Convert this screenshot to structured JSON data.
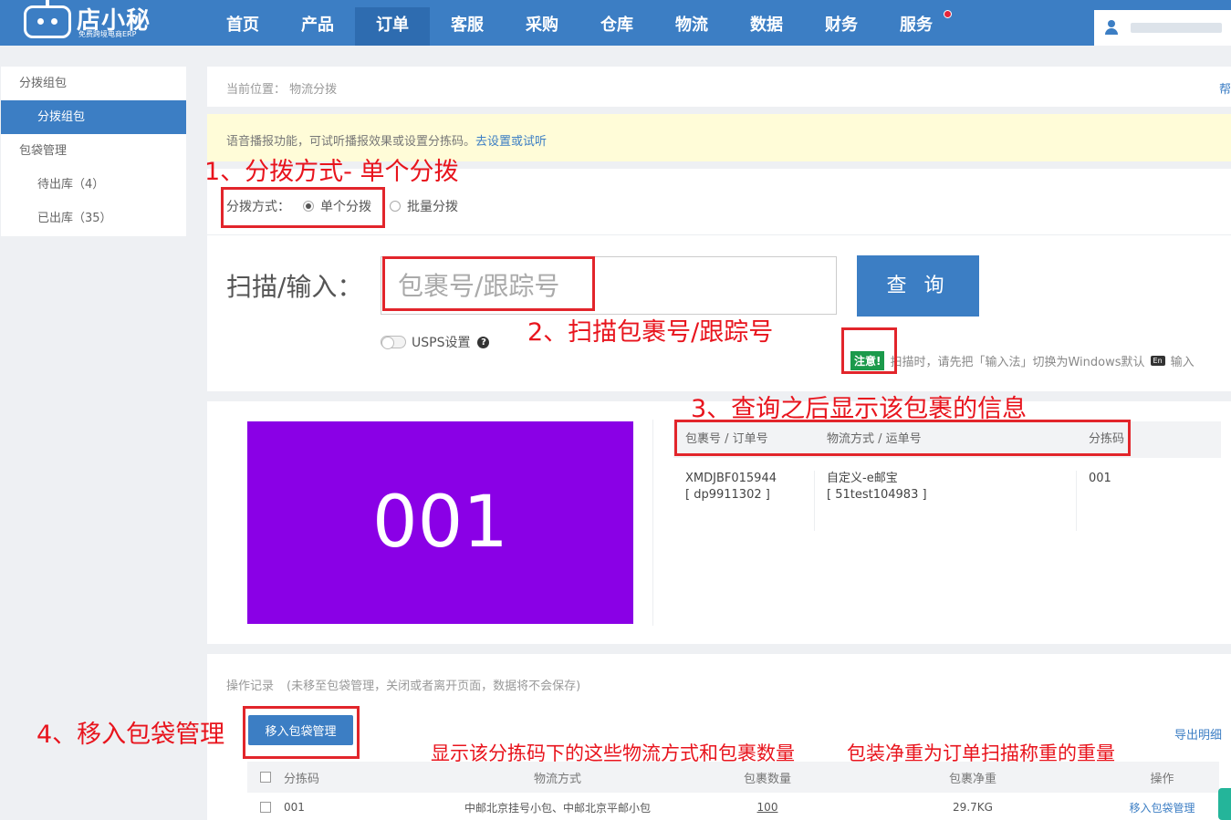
{
  "topbar": {
    "logo_name": "店小秘",
    "logo_sub": "免费跨境电商ERP",
    "nav": [
      "首页",
      "产品",
      "订单",
      "客服",
      "采购",
      "仓库",
      "物流",
      "数据",
      "财务",
      "服务"
    ],
    "active_nav": "订单",
    "user_icon": "user-icon"
  },
  "sidebar": {
    "items": [
      {
        "label": "分拨组包",
        "level": 1
      },
      {
        "label": "分拨组包",
        "level": 2,
        "active": true
      },
      {
        "label": "包袋管理",
        "level": 1
      },
      {
        "label": "待出库（4）",
        "level": 2
      },
      {
        "label": "已出库（35）",
        "level": 2
      }
    ]
  },
  "breadcrumb": {
    "prefix": "当前位置：",
    "current": "物流分拨",
    "help": "帮"
  },
  "notice": {
    "text": "语音播报功能，可试听播报效果或设置分拣码。",
    "link": "去设置或试听"
  },
  "scan": {
    "mode_label": "分拨方式：",
    "mode_single": "单个分拨",
    "mode_batch": "批量分拨",
    "input_label": "扫描/输入：",
    "input_placeholder": "包裹号/跟踪号",
    "query_button": "查 询",
    "usps_label": "USPS设置",
    "help_icon": "?",
    "hint_badge": "注意!",
    "hint_text": "扫描时，请先把「输入法」切换为Windows默认",
    "hint_key": "En",
    "hint_tail": "输入"
  },
  "result": {
    "code": "001",
    "headers": [
      "包裹号 / 订单号",
      "物流方式 / 运单号",
      "分拣码"
    ],
    "row": {
      "package_no": "XMDJBF015944",
      "order_no": "[ dp9911302 ]",
      "logistics": "自定义-e邮宝",
      "waybill": "[ 51test104983 ]",
      "sort_code": "001"
    }
  },
  "log": {
    "title": "操作记录",
    "note": "(未移至包袋管理，关闭或者离开页面，数据将不会保存)",
    "move_button": "移入包袋管理",
    "export_link": "导出明细",
    "headers": [
      "分拣码",
      "物流方式",
      "包裹数量",
      "包裹净重",
      "操作"
    ],
    "rows": [
      {
        "code": "001",
        "method": "中邮北京挂号小包、中邮北京平邮小包",
        "count": "100",
        "weight": "29.7KG",
        "action": "移入包袋管理"
      }
    ]
  },
  "annotations": {
    "step1": "1、分拨方式- 单个分拨",
    "step2": "2、扫描包裹号/跟踪号",
    "step3": "3、查询之后显示该包裹的信息",
    "step4": "4、移入包袋管理",
    "note_methods": "显示该分拣码下的这些物流方式和包裹数量",
    "note_weight": "包装净重为订单扫描称重的重量",
    "color": "#e8141d"
  },
  "colors": {
    "primary": "#3c7ec4",
    "code_box": "#8a00e6",
    "notice_bg": "#fffcd8",
    "badge_green": "#1b9a4b"
  }
}
